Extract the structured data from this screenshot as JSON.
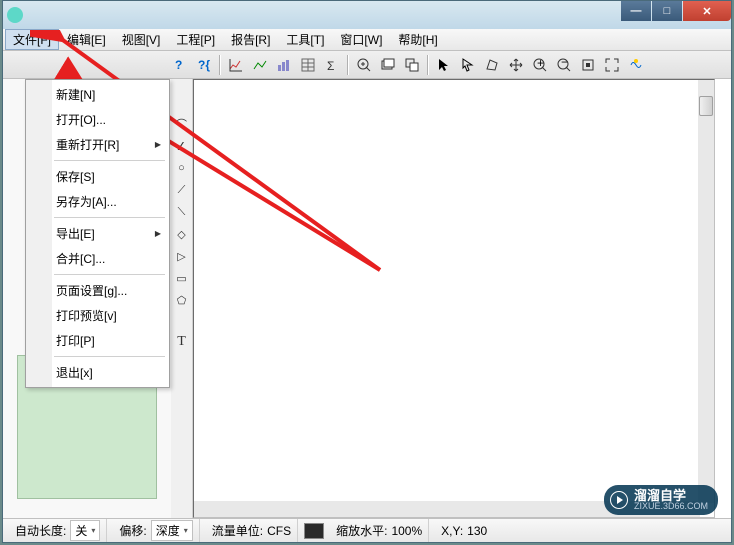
{
  "window": {
    "controls": {
      "min": "—",
      "max": "□",
      "close": "✕"
    }
  },
  "menubar": {
    "file": "文件[F]",
    "edit": "编辑[E]",
    "view": "视图[V]",
    "project": "工程[P]",
    "report": "报告[R]",
    "tool": "工具[T]",
    "window": "窗口[W]",
    "help": "帮助[H]"
  },
  "file_menu": {
    "new_": "新建[N]",
    "open": "打开[O]...",
    "reopen": "重新打开[R]",
    "save": "保存[S]",
    "save_as": "另存为[A]...",
    "export": "导出[E]",
    "merge": "合并[C]...",
    "page_setup": "页面设置[g]...",
    "print_preview": "打印预览[v]",
    "print": "打印[P]",
    "exit": "退出[x]"
  },
  "vert_toolbar": {
    "arc": "⌒",
    "angle": "∠",
    "circle": "○",
    "line1": "⟋",
    "line2": "⟍",
    "diamond": "◇",
    "tri": "▷",
    "rect": "▭",
    "poly": "⬠",
    "text": "T"
  },
  "statusbar": {
    "auto_len_label": "自动长度:",
    "auto_len_value": "关",
    "offset_label": "偏移:",
    "offset_value": "深度",
    "flow_label": "流量单位:",
    "flow_value": "CFS",
    "zoom_label": "缩放水平:",
    "zoom_value": "100%",
    "xy_label": "X,Y:",
    "xy_value": "130"
  },
  "watermark": {
    "title": "溜溜自学",
    "url": "ZIXUE.3D66.COM"
  }
}
